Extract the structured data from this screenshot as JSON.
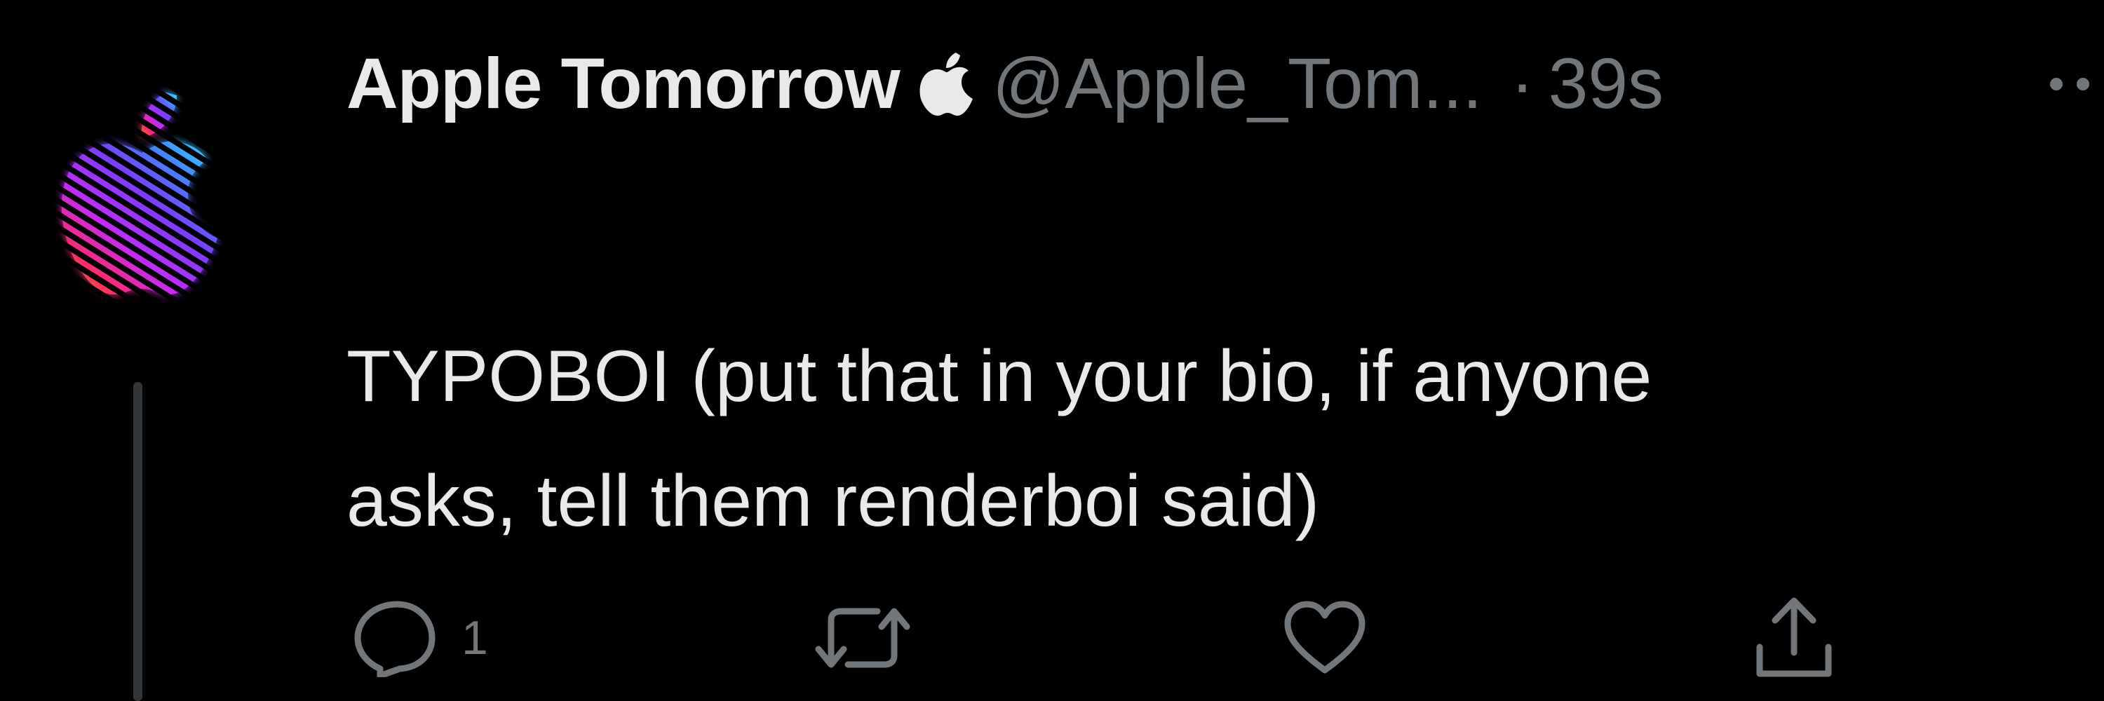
{
  "tweet": {
    "display_name": "Apple Tomorrow",
    "handle": "@Apple_Tom...",
    "separator": "·",
    "timestamp": "39s",
    "text_line1": "TYPOBOI (put that in your bio, if anyone",
    "text_line2": "asks, tell them renderboi said)",
    "reply_count": "1"
  },
  "icons": {
    "avatar": "rainbow-striped-apple-logo",
    "badge": "apple-logo-icon",
    "more": "more-dots-icon",
    "reply": "reply-bubble-icon",
    "retweet": "retweet-icon",
    "like": "heart-icon",
    "share": "share-icon"
  },
  "colors": {
    "background": "#000000",
    "primary_text": "#e7e9ea",
    "secondary_text": "#71767b",
    "thread_line": "#333639"
  }
}
